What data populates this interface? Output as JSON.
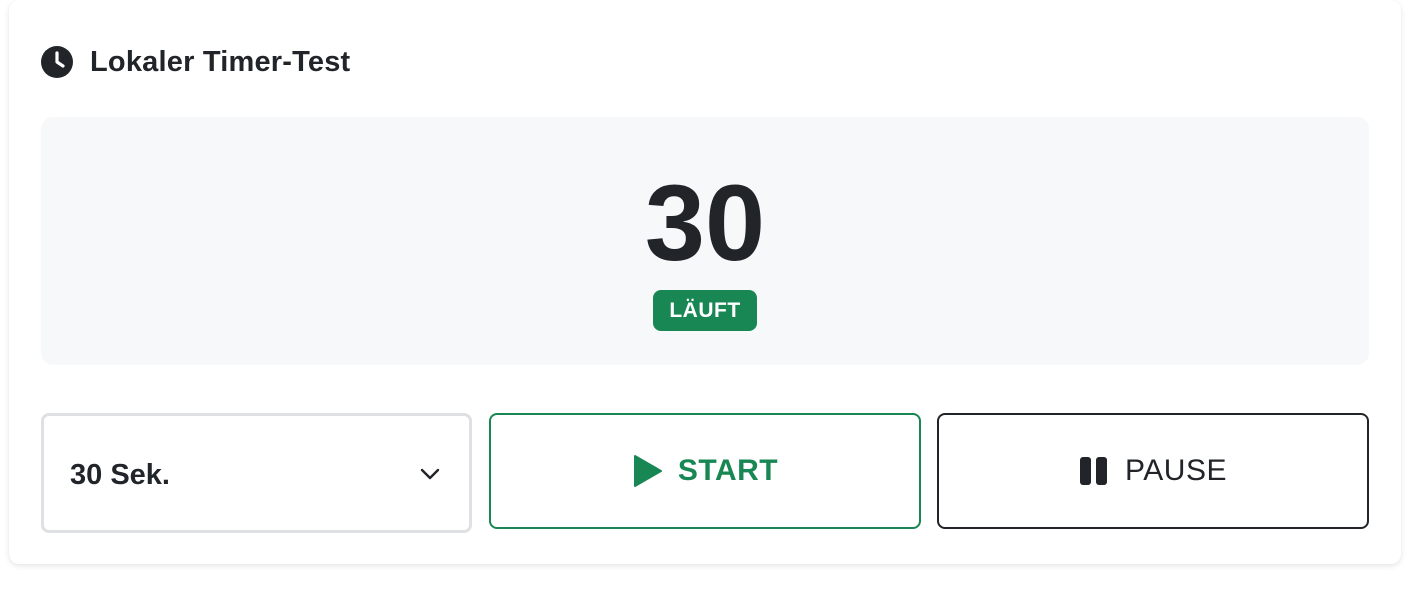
{
  "header": {
    "icon": "clock-icon",
    "title": "Lokaler Timer-Test"
  },
  "display": {
    "seconds_remaining": "30",
    "status": "LÄUFT"
  },
  "controls": {
    "duration_select": {
      "selected": "30 Sek.",
      "icon": "chevron-down-icon"
    },
    "start_button": {
      "label": "START",
      "icon": "play-icon"
    },
    "pause_button": {
      "label": "PAUSE",
      "icon": "pause-icon"
    }
  },
  "colors": {
    "accent_green": "#198754",
    "text_dark": "#212529",
    "display_bg": "#f7f8fa",
    "select_border": "#dee0e4"
  }
}
